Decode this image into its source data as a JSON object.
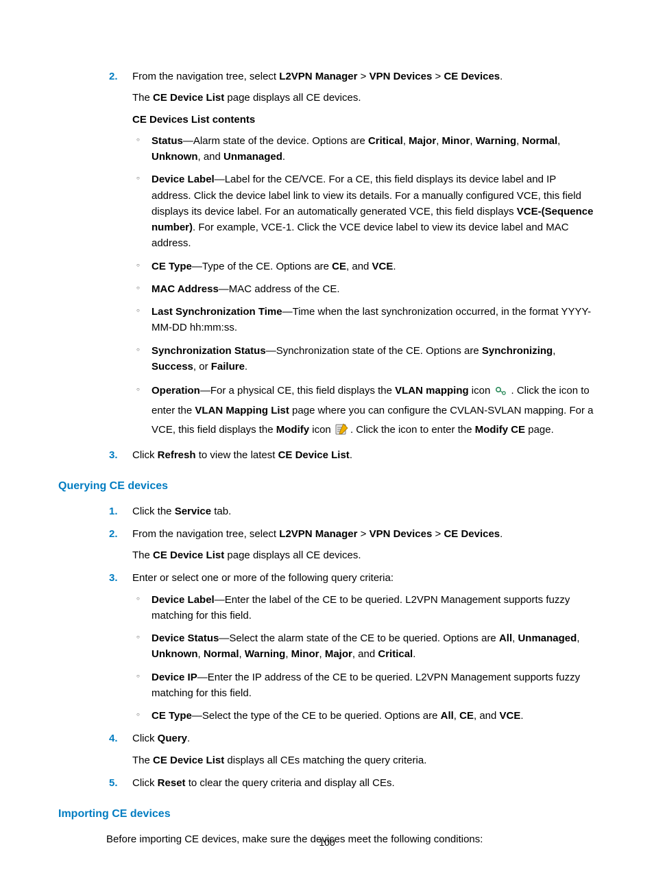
{
  "pageNumber": "100",
  "sec1": {
    "step2": {
      "num": "2.",
      "line1_pre": "From the navigation tree, select ",
      "nav1": "L2VPN Manager",
      "gt": " > ",
      "nav2": "VPN Devices",
      "nav3": "CE Devices",
      "period": ".",
      "line2_pre": "The ",
      "line2_b1": "CE Device List",
      "line2_post": " page displays all CE devices.",
      "contentsHeading": "CE Devices List contents",
      "ul": {
        "status": {
          "b1": "Status",
          "dash": "—Alarm state of the device. Options are ",
          "opt1": "Critical",
          "c": ", ",
          "opt2": "Major",
          "opt3": "Minor",
          "opt4": "Warning",
          "opt5": "Normal",
          "opt6": "Unknown",
          "and": ", and ",
          "opt7": "Unmanaged",
          "end": "."
        },
        "deviceLabel": {
          "b1": "Device Label",
          "t1": "—Label for the CE/VCE. For a CE, this field displays its device label and IP address. Click the device label link to view its details. For a manually configured VCE, this field displays its device label. For an automatically generated VCE, this field displays ",
          "b2": "VCE-(Sequence number)",
          "t2": ". For example, VCE-1. Click the VCE device label to view its device label and MAC address."
        },
        "ceType": {
          "b1": "CE Type",
          "t1": "—Type of the CE. Options are ",
          "b2": "CE",
          "t2": ", and ",
          "b3": "VCE",
          "t3": "."
        },
        "mac": {
          "b1": "MAC Address",
          "t1": "—MAC address of the CE."
        },
        "lastSync": {
          "b1": "Last Synchronization Time",
          "t1": "—Time when the last synchronization occurred, in the format YYYY-MM-DD hh:mm:ss."
        },
        "syncStatus": {
          "b1": "Synchronization Status",
          "t1": "—Synchronization state of the CE. Options are ",
          "b2": "Synchronizing",
          "c": ", ",
          "b3": "Success",
          "or": ", or ",
          "b4": "Failure",
          "end": "."
        },
        "operation": {
          "b1": "Operation",
          "t1": "—For a physical CE, this field displays the ",
          "b2": "VLAN mapping",
          "t2": " icon ",
          "t3": ". Click the icon to enter the ",
          "b3": "VLAN Mapping List",
          "t4": " page where you can configure the CVLAN-SVLAN mapping. For a VCE, this field displays the ",
          "b4": "Modify",
          "t5": " icon ",
          "t6": ". Click the icon to enter the ",
          "b5": "Modify CE",
          "t7": " page."
        }
      }
    },
    "step3": {
      "num": "3.",
      "t1": "Click ",
      "b1": "Refresh",
      "t2": " to view the latest ",
      "b2": "CE Device List",
      "t3": "."
    }
  },
  "h_query": "Querying CE devices",
  "sec2": {
    "s1": {
      "num": "1.",
      "t1": "Click the ",
      "b1": "Service",
      "t2": " tab."
    },
    "s2": {
      "num": "2.",
      "line1_pre": "From the navigation tree, select ",
      "nav1": "L2VPN Manager",
      "gt": " > ",
      "nav2": "VPN Devices",
      "nav3": "CE Devices",
      "period": ".",
      "line2_pre": "The ",
      "line2_b1": "CE Device List",
      "line2_post": " page displays all CE devices."
    },
    "s3": {
      "num": "3.",
      "intro": "Enter or select one or more of the following query criteria:",
      "ul": {
        "dl": {
          "b1": "Device Label",
          "t1": "—Enter the label of the CE to be queried. L2VPN Management supports fuzzy matching for this field."
        },
        "ds": {
          "b1": "Device Status",
          "t1": "—Select the alarm state of the CE to be queried. Options are ",
          "b2": "All",
          "c": ", ",
          "b3": "Unmanaged",
          "b4": "Unknown",
          "b5": "Normal",
          "b6": "Warning",
          "b7": "Minor",
          "b8": "Major",
          "and": ", and ",
          "b9": "Critical",
          "end": "."
        },
        "dip": {
          "b1": "Device IP",
          "t1": "—Enter the IP address of the CE to be queried. L2VPN Management supports fuzzy matching for this field."
        },
        "ct": {
          "b1": "CE Type",
          "t1": "—Select the type of the CE to be queried. Options are ",
          "b2": "All",
          "c": ", ",
          "b3": "CE",
          "and": ", and ",
          "b4": "VCE",
          "end": "."
        }
      }
    },
    "s4": {
      "num": "4.",
      "t1": "Click ",
      "b1": "Query",
      "t2": ".",
      "line2_pre": "The ",
      "line2_b1": "CE Device List",
      "line2_post": " displays all CEs matching the query criteria."
    },
    "s5": {
      "num": "5.",
      "t1": "Click ",
      "b1": "Reset",
      "t2": " to clear the query criteria and display all CEs."
    }
  },
  "h_import": "Importing CE devices",
  "sec3": {
    "intro": "Before importing CE devices, make sure the devices meet the following conditions:"
  }
}
